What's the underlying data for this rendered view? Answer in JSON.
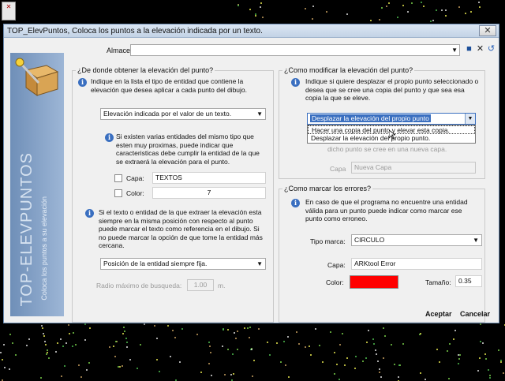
{
  "app_icon_text": "✕",
  "window": {
    "title": "TOP_ElevPuntos, Coloca los puntos a la elevación indicada por un texto.",
    "close_glyph": "✕"
  },
  "sidebar": {
    "vertical_title": "TOP-ELEVPUNTOS",
    "vertical_subtitle": "Coloca los puntos a su elevación"
  },
  "almacen": {
    "label": "Almacen",
    "value": ""
  },
  "left_group": {
    "title": "¿De donde obtener la elevación del punto?",
    "info1": "Indique en la lista el tipo de entidad que contiene la elevación que desea aplicar a cada punto del dibujo.",
    "entity_combo": "Elevación indicada por el valor de un texto.",
    "info2": "Si existen varias entidades del mismo tipo que esten muy proximas, puede indicar que caracteristicas debe cumplir la entidad de la que se extraerá la elevación para el punto.",
    "capa_label": "Capa:",
    "capa_value": "TEXTOS",
    "color_label": "Color:",
    "color_value": "7",
    "info3": "Si el texto o entidad de la que extraer la elevación esta siempre en la misma posición con respecto al punto puede marcar el texto como referencia en el dibujo. Si no puede marcar la opción de que tome la entidad más cercana.",
    "position_combo": "Posición de la entidad siempre fija.",
    "radio_label": "Radio máximo de busqueda:",
    "radio_value": "1.00",
    "radio_unit": "m."
  },
  "right_group": {
    "title": "¿Como modificar la elevación del punto?",
    "info": "Indique si quiere desplazar el propio punto seleccionado o desea que se cree una copia del punto y que sea esa copia la que se eleve.",
    "mode_combo": "Desplazar la elevación del propio punto",
    "dropdown_options": [
      "Hacer una copia del punto y elevar esta copia.",
      "Desplazar la elevación del propio punto."
    ],
    "hidden_text": "dicho punto se cree en una nueva capa.",
    "capa_label": "Capa",
    "capa_value": "Nueva Capa"
  },
  "errors_group": {
    "title": "¿Como marcar los errores?",
    "info": "En caso de que el programa no encuentre una entidad válida para un punto puede indicar como marcar ese punto como erroneo.",
    "tipo_label": "Tipo marca:",
    "tipo_value": "CIRCULO",
    "capa_label": "Capa:",
    "capa_value": "ARKtool Error",
    "color_label": "Color:",
    "color_hex": "#ff0000",
    "tamano_label": "Tamaño:",
    "tamano_value": "0.35"
  },
  "footer": {
    "accept": "Aceptar",
    "cancel": "Cancelar"
  },
  "colors": {
    "title_bar": "#c3d3e6",
    "sidebar": "#6f8fb8",
    "error_color": "#ff0000"
  }
}
